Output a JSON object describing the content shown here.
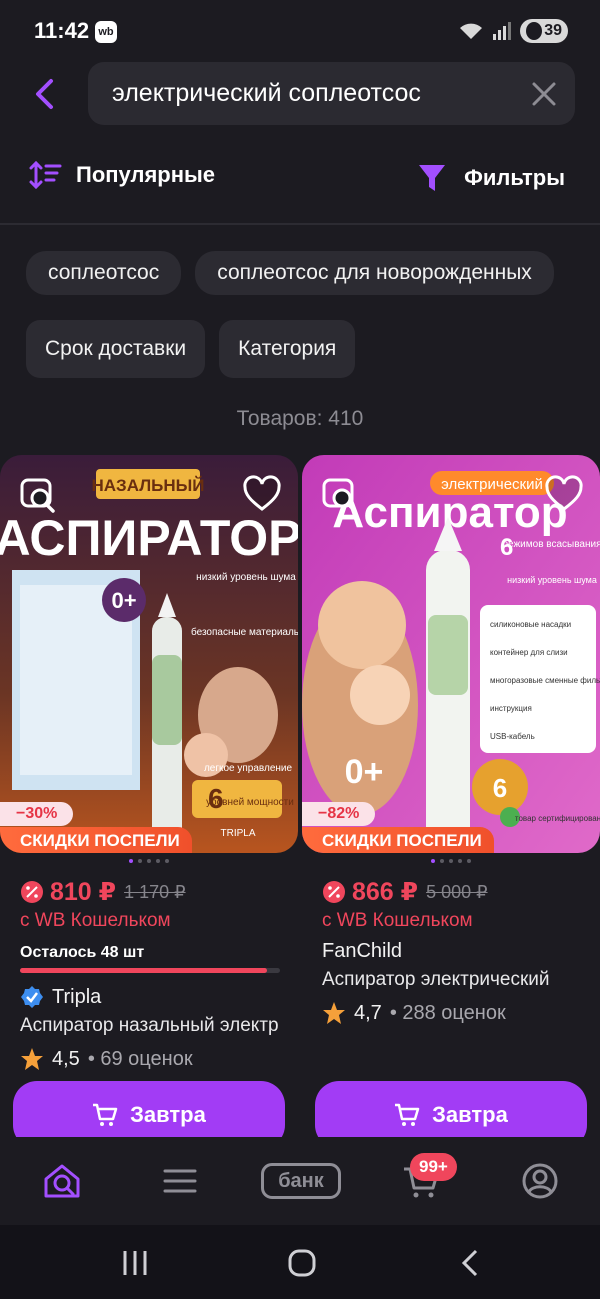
{
  "status": {
    "time": "11:42",
    "app_badge": "wb",
    "battery": "39"
  },
  "search": {
    "query": "электрический соплеотсос"
  },
  "sort": {
    "label": "Популярные"
  },
  "filters": {
    "label": "Фильтры"
  },
  "chips_row1": [
    "соплеотсос",
    "соплеотсос для новорожденных"
  ],
  "chips_row2": [
    "Срок доставки",
    "Категория"
  ],
  "results_count": "Товаров: 410",
  "products": [
    {
      "discount": "−30%",
      "promo": "СКИДКИ ПОСПЕЛИ",
      "price": "810 ₽",
      "old_price": "1 170 ₽",
      "wallet": "с WB Кошельком",
      "stock": "Осталось 48 шт",
      "stock_level": 0.95,
      "brand": "Tripla",
      "name": "Аспиратор назальный электрический",
      "rating": "4,5",
      "reviews": "• 69 оценок",
      "buy_label": "Завтра",
      "image_text": {
        "top": "НАЗАЛЬНЫЙ",
        "big": "АСПИРАТОР",
        "age": "0+",
        "f1": "низкий уровень шума",
        "f2": "безопасные материалы",
        "f3": "легкое управление",
        "f4num": "6",
        "f4": "уровней мощности",
        "maker": "TRIPLA"
      }
    },
    {
      "discount": "−82%",
      "promo": "СКИДКИ ПОСПЕЛИ",
      "price": "866 ₽",
      "old_price": "5 000 ₽",
      "wallet": "с WB Кошельком",
      "brand": "FanChild",
      "name": "Аспиратор электрический",
      "rating": "4,7",
      "reviews": "• 288 оценок",
      "buy_label": "Завтра",
      "image_text": {
        "top": "электрический",
        "big": "Аспиратор",
        "modes_num": "6",
        "modes": "режимов всасывания",
        "noise": "низкий уровень шума",
        "age": "0+",
        "l1": "силиконовые насадки",
        "l2": "контейнер для слизи",
        "l3": "многоразовые сменные фильтры",
        "l4": "инструкция",
        "l5": "USB-кабель",
        "cert": "товар сертифицирован",
        "warranty": "6"
      }
    }
  ],
  "bottom_nav": {
    "bank_label": "банк",
    "cart_badge": "99+"
  },
  "colors": {
    "accent": "#a23cf5",
    "price": "#f0465c",
    "background": "#1c1b21"
  }
}
